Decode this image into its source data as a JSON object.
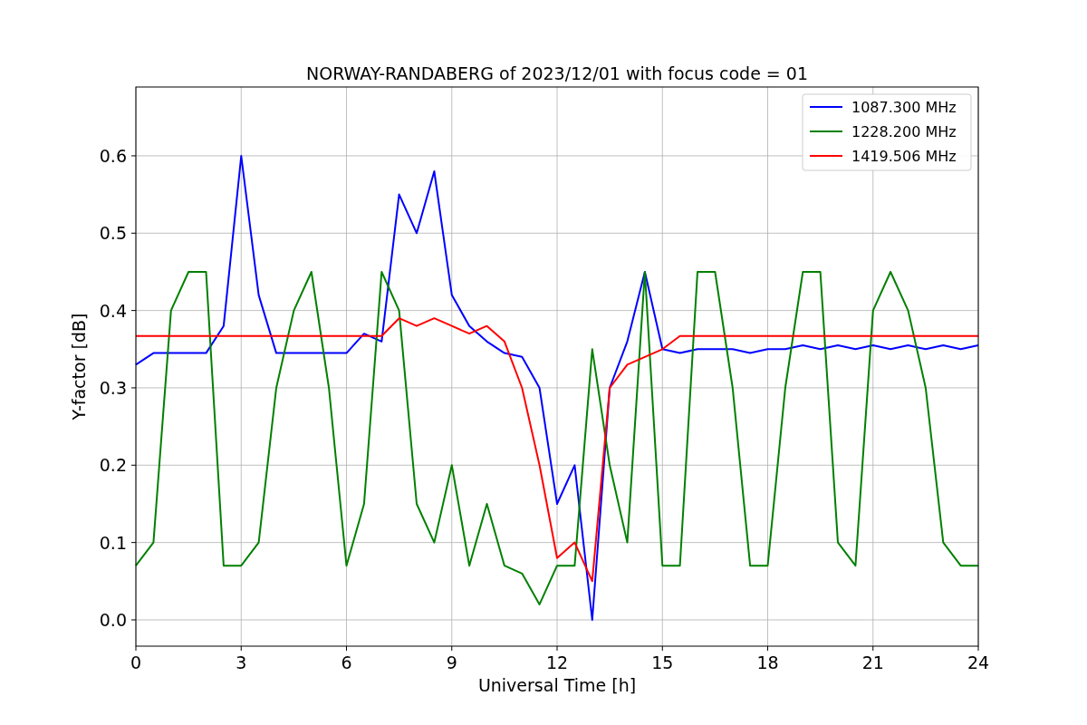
{
  "figure": {
    "chart_data": {
      "type": "line",
      "title": "NORWAY-RANDABERG of 2023/12/01 with focus code = 01",
      "xlabel": "Universal Time [h]",
      "ylabel": "Y-factor [dB]",
      "x": [
        0,
        0.5,
        1,
        1.5,
        2,
        2.5,
        3,
        3.5,
        4,
        4.5,
        5,
        5.5,
        6,
        6.5,
        7,
        7.5,
        8,
        8.5,
        9,
        9.5,
        10,
        10.5,
        11,
        11.5,
        12,
        12.5,
        13,
        13.5,
        14,
        14.5,
        15,
        15.5,
        16,
        16.5,
        17,
        17.5,
        18,
        18.5,
        19,
        19.5,
        20,
        20.5,
        21,
        21.5,
        22,
        22.5,
        23,
        23.5,
        24
      ],
      "series": [
        {
          "name": "1087.300 MHz",
          "color": "#0000ff",
          "values": [
            0.33,
            0.345,
            0.345,
            0.345,
            0.345,
            0.38,
            0.6,
            0.42,
            0.345,
            0.345,
            0.345,
            0.345,
            0.345,
            0.37,
            0.36,
            0.55,
            0.5,
            0.58,
            0.42,
            0.38,
            0.36,
            0.345,
            0.34,
            0.3,
            0.15,
            0.2,
            0.0,
            0.3,
            0.36,
            0.45,
            0.35,
            0.345,
            0.35,
            0.35,
            0.35,
            0.345,
            0.35,
            0.35,
            0.355,
            0.35,
            0.355,
            0.35,
            0.355,
            0.35,
            0.355,
            0.35,
            0.355,
            0.35,
            0.355
          ]
        },
        {
          "name": "1228.200 MHz",
          "color": "#008000",
          "values": [
            0.07,
            0.1,
            0.4,
            0.45,
            0.45,
            0.07,
            0.07,
            0.1,
            0.3,
            0.4,
            0.45,
            0.3,
            0.07,
            0.15,
            0.45,
            0.4,
            0.15,
            0.1,
            0.2,
            0.07,
            0.15,
            0.07,
            0.06,
            0.02,
            0.07,
            0.07,
            0.35,
            0.2,
            0.1,
            0.45,
            0.07,
            0.07,
            0.45,
            0.45,
            0.3,
            0.07,
            0.07,
            0.3,
            0.45,
            0.45,
            0.1,
            0.07,
            0.4,
            0.45,
            0.4,
            0.3,
            0.1,
            0.07,
            0.07
          ]
        },
        {
          "name": "1419.506 MHz",
          "color": "#ff0000",
          "values": [
            0.367,
            0.367,
            0.367,
            0.367,
            0.367,
            0.367,
            0.367,
            0.367,
            0.367,
            0.367,
            0.367,
            0.367,
            0.367,
            0.367,
            0.367,
            0.39,
            0.38,
            0.39,
            0.38,
            0.37,
            0.38,
            0.36,
            0.3,
            0.2,
            0.08,
            0.1,
            0.05,
            0.3,
            0.33,
            0.34,
            0.35,
            0.367,
            0.367,
            0.367,
            0.367,
            0.367,
            0.367,
            0.367,
            0.367,
            0.367,
            0.367,
            0.367,
            0.367,
            0.367,
            0.367,
            0.367,
            0.367,
            0.367,
            0.367
          ]
        }
      ],
      "grid": true,
      "legend": true,
      "xlim": [
        0,
        24
      ],
      "ylim": [
        -0.034,
        0.689
      ],
      "xticks": [
        0,
        3,
        6,
        9,
        12,
        15,
        18,
        21,
        24
      ],
      "yticks": [
        {
          "value": 0,
          "label": "0.0"
        },
        {
          "value": 0.1,
          "label": "0.1"
        },
        {
          "value": 0.2,
          "label": "0.2"
        },
        {
          "value": 0.3,
          "label": "0.3"
        },
        {
          "value": 0.4,
          "label": "0.4"
        },
        {
          "value": 0.5,
          "label": "0.5"
        },
        {
          "value": 0.6,
          "label": "0.6"
        }
      ]
    }
  }
}
